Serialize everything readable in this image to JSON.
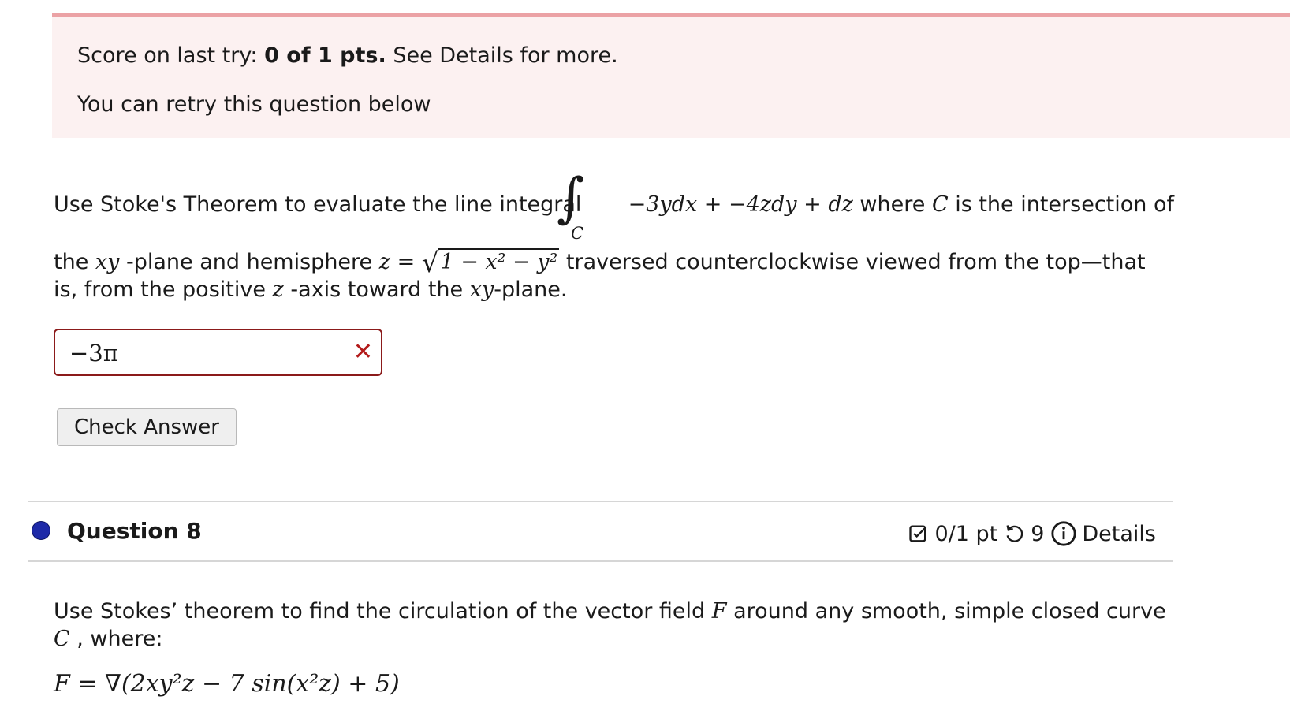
{
  "alert": {
    "score_prefix": "Score on last try: ",
    "score_value": "0 of 1 pts.",
    "score_suffix": " See Details for more.",
    "retry_text": "You can retry this question below"
  },
  "question7": {
    "text_part1": "Use Stoke's Theorem to evaluate the line integral",
    "integral_sub": "C",
    "integrand": "−3ydx + −4zdy + dz",
    "text_part2": " where ",
    "var_C": "C",
    "text_part3": " is the intersection of",
    "line2_a": "the ",
    "line2_xy": "xy",
    "line2_b": " -plane and hemisphere ",
    "line2_z": "z",
    "line2_eq": " = ",
    "sqrt_content": "1 − x² − y²",
    "line2_c": " traversed counterclockwise viewed from the top—that",
    "line3_a": "is, from the positive ",
    "line3_z": "z",
    "line3_b": " -axis toward the ",
    "line3_xy": "xy",
    "line3_c": "-plane.",
    "answer_value": "−3π",
    "incorrect_mark": "✕",
    "check_button": "Check Answer"
  },
  "question8": {
    "title": "Question 8",
    "score": "0/1 pt",
    "attempts": "9",
    "details": "Details",
    "text_line1_a": "Use Stokes’ theorem to find the circulation of the vector field ",
    "text_line1_F": "F",
    "text_line1_b": " around any smooth, simple closed curve",
    "text_line2_C": "C",
    "text_line2_b": " , where:",
    "formula": "F = ∇(2xy²z − 7 sin(x²z) + 5)"
  },
  "colors": {
    "alert_bg": "#fcf1f1",
    "alert_border": "#eba2a5",
    "error_red": "#b31b1b",
    "question_dot": "#1e2aa8"
  }
}
